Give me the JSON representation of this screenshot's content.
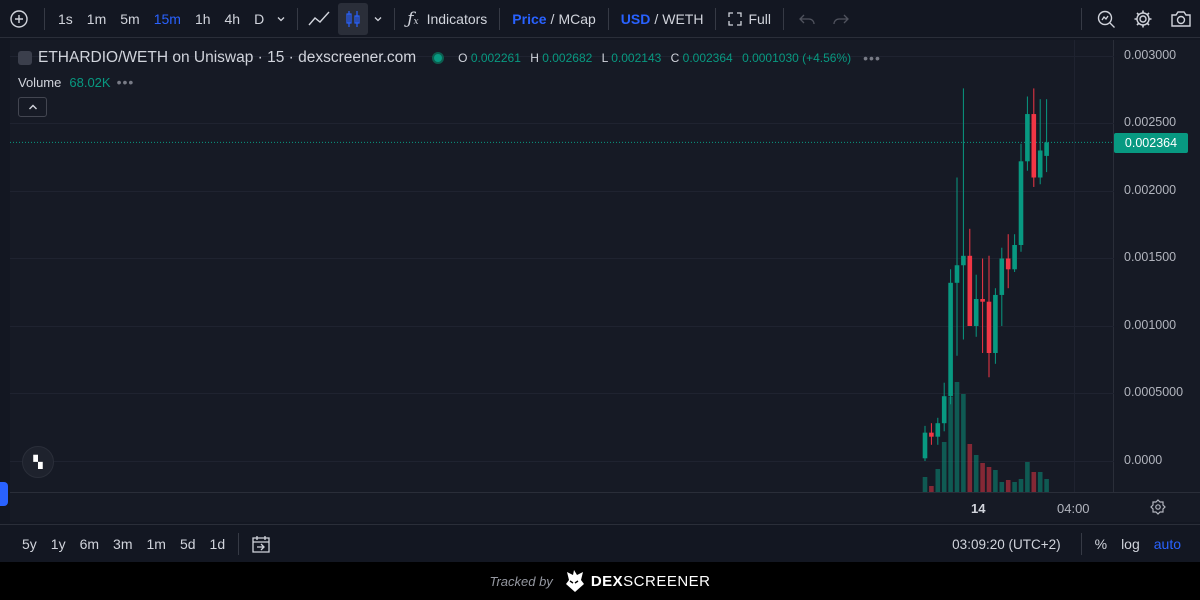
{
  "toolbar": {
    "intervals": [
      "1s",
      "1m",
      "5m",
      "15m",
      "1h",
      "4h",
      "D"
    ],
    "active_interval": "15m",
    "indicators_label": "Indicators",
    "price_label": "Price",
    "mcap_label": "MCap",
    "usd_label": "USD",
    "weth_label": "WETH",
    "full_label": "Full",
    "price_sep": "/",
    "currency_sep": "/"
  },
  "legend": {
    "symbol": "ETHARDIO/WETH on Uniswap · 15 · dexscreener.com",
    "o_label": "O",
    "o_value": "0.002261",
    "h_label": "H",
    "h_value": "0.002682",
    "l_label": "L",
    "l_value": "0.002143",
    "c_label": "C",
    "c_value": "0.002364",
    "change": "0.0001030 (+4.56%)",
    "more_dots": "•••",
    "volume_label": "Volume",
    "volume_value": "68.02K",
    "volume_dots": "•••"
  },
  "price_axis": {
    "ticks": [
      "0.003000",
      "0.002500",
      "0.002000",
      "0.001500",
      "0.001000",
      "0.0005000",
      "0.0000"
    ],
    "last_price": "0.002364"
  },
  "time_axis": {
    "labels": [
      "14",
      "04:00"
    ]
  },
  "bottom_bar": {
    "ranges": [
      "5y",
      "1y",
      "6m",
      "3m",
      "1m",
      "5d",
      "1d"
    ],
    "clock": "03:09:20 (UTC+2)",
    "percent": "%",
    "log": "log",
    "auto": "auto"
  },
  "footer": {
    "tracked_by": "Tracked by",
    "brand_dex": "DEX",
    "brand_screener": "SCREENER"
  },
  "colors": {
    "up": "#089981",
    "down": "#f23645",
    "accent": "#2962ff",
    "background": "#131722"
  },
  "chart_data": {
    "type": "candlestick",
    "ylim": [
      -0.0002,
      0.0031
    ],
    "y_ticks": [
      0,
      0.0005,
      0.001,
      0.0015,
      0.002,
      0.0025,
      0.003
    ],
    "candles": [
      {
        "o": 2e-05,
        "h": 0.00026,
        "l": 0.0,
        "c": 0.00021
      },
      {
        "o": 0.00021,
        "h": 0.00028,
        "l": 0.00012,
        "c": 0.00018
      },
      {
        "o": 0.00018,
        "h": 0.00032,
        "l": 0.00012,
        "c": 0.00028
      },
      {
        "o": 0.00028,
        "h": 0.00058,
        "l": 0.00022,
        "c": 0.00048
      },
      {
        "o": 0.00048,
        "h": 0.00142,
        "l": 0.00042,
        "c": 0.00132
      },
      {
        "o": 0.00132,
        "h": 0.0021,
        "l": 0.00078,
        "c": 0.00145
      },
      {
        "o": 0.00145,
        "h": 0.00276,
        "l": 0.0009,
        "c": 0.00152
      },
      {
        "o": 0.00152,
        "h": 0.00172,
        "l": 0.001,
        "c": 0.001
      },
      {
        "o": 0.001,
        "h": 0.00138,
        "l": 0.00092,
        "c": 0.0012
      },
      {
        "o": 0.0012,
        "h": 0.0015,
        "l": 0.0008,
        "c": 0.00118
      },
      {
        "o": 0.00118,
        "h": 0.00152,
        "l": 0.00062,
        "c": 0.0008
      },
      {
        "o": 0.0008,
        "h": 0.00128,
        "l": 0.00072,
        "c": 0.00123
      },
      {
        "o": 0.00123,
        "h": 0.00158,
        "l": 0.001,
        "c": 0.0015
      },
      {
        "o": 0.0015,
        "h": 0.00168,
        "l": 0.00128,
        "c": 0.00142
      },
      {
        "o": 0.00142,
        "h": 0.00168,
        "l": 0.0014,
        "c": 0.0016
      },
      {
        "o": 0.0016,
        "h": 0.00235,
        "l": 0.00155,
        "c": 0.00222
      },
      {
        "o": 0.00222,
        "h": 0.0027,
        "l": 0.00215,
        "c": 0.00257
      },
      {
        "o": 0.00257,
        "h": 0.00276,
        "l": 0.00203,
        "c": 0.0021
      },
      {
        "o": 0.0021,
        "h": 0.00268,
        "l": 0.00205,
        "c": 0.0023
      },
      {
        "o": 0.00226,
        "h": 0.00268,
        "l": 0.00214,
        "c": 0.00236
      }
    ],
    "volumes": [
      15,
      6,
      23,
      50,
      95,
      110,
      98,
      48,
      37,
      29,
      25,
      22,
      10,
      12,
      10,
      13,
      30,
      20,
      20,
      13
    ]
  }
}
